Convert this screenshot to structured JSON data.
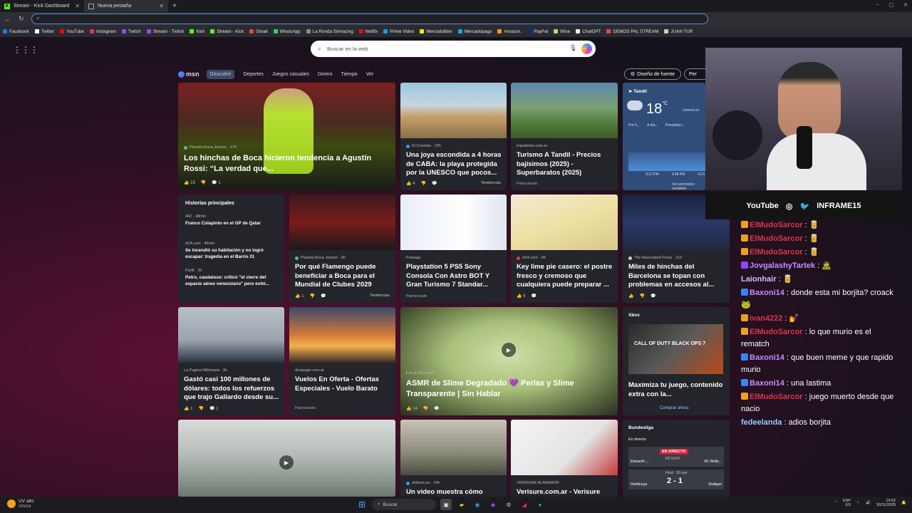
{
  "tabs": [
    {
      "label": "Stream - Kick Dashboard"
    },
    {
      "label": "Nueva pestaña"
    }
  ],
  "window_controls": [
    "–",
    "▢",
    "✕"
  ],
  "bookmarks": [
    {
      "label": "Facebook",
      "color": "#1877f2"
    },
    {
      "label": "Twitter",
      "color": "#fff"
    },
    {
      "label": "YouTube",
      "color": "#ff0000"
    },
    {
      "label": "Instagram",
      "color": "#e1306c"
    },
    {
      "label": "Twitch",
      "color": "#9146ff"
    },
    {
      "label": "Stream - Twitch",
      "color": "#9146ff"
    },
    {
      "label": "Kick",
      "color": "#53fc18"
    },
    {
      "label": "Stream - Kick",
      "color": "#53fc18"
    },
    {
      "label": "Gmail",
      "color": "#ea4335"
    },
    {
      "label": "WhatsApp",
      "color": "#25d366"
    },
    {
      "label": "La Ronda Simracing",
      "color": "#888"
    },
    {
      "label": "Netflix",
      "color": "#e50914"
    },
    {
      "label": "Prime Video",
      "color": "#00a8e1"
    },
    {
      "label": "Mercadolibre",
      "color": "#ffe600"
    },
    {
      "label": "Mercadopago",
      "color": "#00b1ea"
    },
    {
      "label": "Amazon.",
      "color": "#ff9900"
    },
    {
      "label": "PayPal",
      "color": "#003087"
    },
    {
      "label": "Wise",
      "color": "#9fe870"
    },
    {
      "label": "ChatGPT",
      "color": "#fff"
    },
    {
      "label": "DEMOS PAL STREAM",
      "color": "#e44"
    },
    {
      "label": "JUAN TUR",
      "color": "#ccc"
    }
  ],
  "search": {
    "placeholder": "Buscar en la web"
  },
  "msn": {
    "logo": "msn",
    "nav": [
      "Descubrir",
      "Deportes",
      "Juegos casuales",
      "Dinero",
      "Tiempo",
      "Ver"
    ],
    "design_button": "Diseño de fuente",
    "personalize": "Per"
  },
  "cards": {
    "boca": {
      "source": "Planeta Boca Juniors · 17h",
      "title": "Los hinchas de Boca hicieron tendencia a Agustín Rossi: “La verdad que...",
      "likes": "18",
      "comments": "1"
    },
    "cronista": {
      "source": "El Cronista · 23h",
      "title": "Una joya escondida a 4 horas de CABA: la playa protegida por la UNESCO que pocos...",
      "likes": "4",
      "trend": "Tendencias"
    },
    "tandil": {
      "source": "tripadvisor.com.ar",
      "title": "Turismo A Tandil - Precios bajísimos (2025) - Superbaratos (2025)",
      "sponsored": "Patrocinado"
    },
    "weather": {
      "city": "Tandil",
      "temp": "18",
      "unit": "°C",
      "note": "Lloverá en",
      "tabs": [
        "Por h...",
        "A día...",
        "Precipitaci..."
      ],
      "times": [
        "3:12 PM",
        "3:48 PM",
        "4:24"
      ],
      "link": "Ver pronóstico completo"
    },
    "historias": {
      "header": "Historias principales",
      "items": [
        {
          "source": "442 · 48min",
          "title": "Franco Colapinto en el GP de Qatar"
        },
        {
          "source": "A24.com · 46min",
          "title": "Se incendió su habitación y no logró escapar: tragedia en el Barrio 31"
        },
        {
          "source": "Perfil · 3h",
          "title": "Petro, caudaloso: criticó \"el cierre del espacio aéreo venezolano\" pero evitó..."
        }
      ]
    },
    "flamengo": {
      "source": "Planeta Boca Juniors · 6h",
      "title": "Por qué Flamengo puede beneficiar a Boca para el Mundial de Clubes 2029",
      "likes": "1",
      "trend": "Tendencias"
    },
    "ps5": {
      "source": "Fravega",
      "title": "Playstation 5 PS5 Sony Consola Con Astro BOT Y Gran Turismo 7 Standar...",
      "sponsored": "Patrocinado"
    },
    "lime": {
      "source": "A24.com · 3d",
      "title": "Key lime pie casero: el postre fresco y cremoso que cualquiera puede preparar ...",
      "likes": "6"
    },
    "barca": {
      "source": "The Associated Press · 21h",
      "title": "Miles de hinchas del Barcelona se topan con problemas en accesos al..."
    },
    "gallardo": {
      "source": "La Pagina Millonaria · 3h",
      "title": "Gastó casi 100 millones de dólares: todos los refuerzos que trajo Gallardo desde su...",
      "likes": "1",
      "comments": "1"
    },
    "vuelos": {
      "source": "despegar.com.ar",
      "title": "Vuelos En Oferta - Ofertas Especiales - Vuelo Barato",
      "sponsored": "Patrocinado"
    },
    "slime": {
      "source": "Fun & Diversión",
      "title": "ASMR de Slime Degradado 💜 Perlas y Slime Transparente | Sin Hablar",
      "likes": "14"
    },
    "xbox": {
      "header": "Xbox",
      "title": "Maximiza tu juego, contenido extra con la...",
      "link": "Comprar ahora",
      "game": "CALL OF DUTY BLACK OPS 7"
    },
    "eldiario": {
      "source": "eldiario.es · 14h",
      "title": "Un video muestra cómo"
    },
    "verisure": {
      "source": "VERISURE ALARMAS®",
      "title": "Verisure.com.ar - Verisure"
    },
    "bundesliga": {
      "header": "Bundesliga",
      "live": "En directo",
      "live_badge": "EN DIRECTO",
      "team1": "Eintracht ...",
      "team2": "VfL Wolfs...",
      "clock": "HZ 63:47",
      "team3": "Hamburgo",
      "team4": "Stuttgart",
      "final": "Final · 30 nov",
      "score": "2 - 1"
    }
  },
  "stream": {
    "social": [
      "YouTube",
      "INFRAME15"
    ]
  },
  "chat": [
    {
      "user": "ElMudoSarcor",
      "text": "🥫",
      "color": "#e0344a",
      "badge": "#f0a020"
    },
    {
      "user": "ElMudoSarcor",
      "text": "🥫",
      "color": "#e0344a",
      "badge": "#f0a020"
    },
    {
      "user": "ElMudoSarcor",
      "text": "🥫",
      "color": "#e0344a",
      "badge": "#f0a020"
    },
    {
      "user": "JovgalashyTartek",
      "text": "🧟",
      "color": "#c98bff",
      "badge": "#9146ff"
    },
    {
      "user": "Laionhair",
      "text": "🥫",
      "color": "#c8c0ff",
      "badge": ""
    },
    {
      "user": "Baxoni14",
      "text": "donde esta mi borjita? croack 🐸",
      "color": "#c98bff",
      "badge": "#3b82f6"
    },
    {
      "user": "ivan4222",
      "text": "💅",
      "color": "#e0344a",
      "badge": "#f0a020"
    },
    {
      "user": "ElMudoSarcor",
      "text": "lo que murio es el rematch",
      "color": "#e0344a",
      "badge": "#f0a020"
    },
    {
      "user": "Baxoni14",
      "text": "que buen meme y que rapido murio",
      "color": "#c98bff",
      "badge": "#3b82f6"
    },
    {
      "user": "Baxoni14",
      "text": "una lastima",
      "color": "#c98bff",
      "badge": "#3b82f6"
    },
    {
      "user": "ElMudoSarcor",
      "text": "juego muerto desde que nacio",
      "color": "#e0344a",
      "badge": "#f0a020"
    },
    {
      "user": "fedeelanda",
      "text": "adios borjita",
      "color": "#9ec8ff",
      "badge": ""
    }
  ],
  "taskbar": {
    "weather": "UV alto",
    "weather_sub": "Ahora",
    "search": "Buscar",
    "lang": "ESP",
    "lang_sub": "ES",
    "time": "14:52",
    "date": "30/11/2025"
  }
}
